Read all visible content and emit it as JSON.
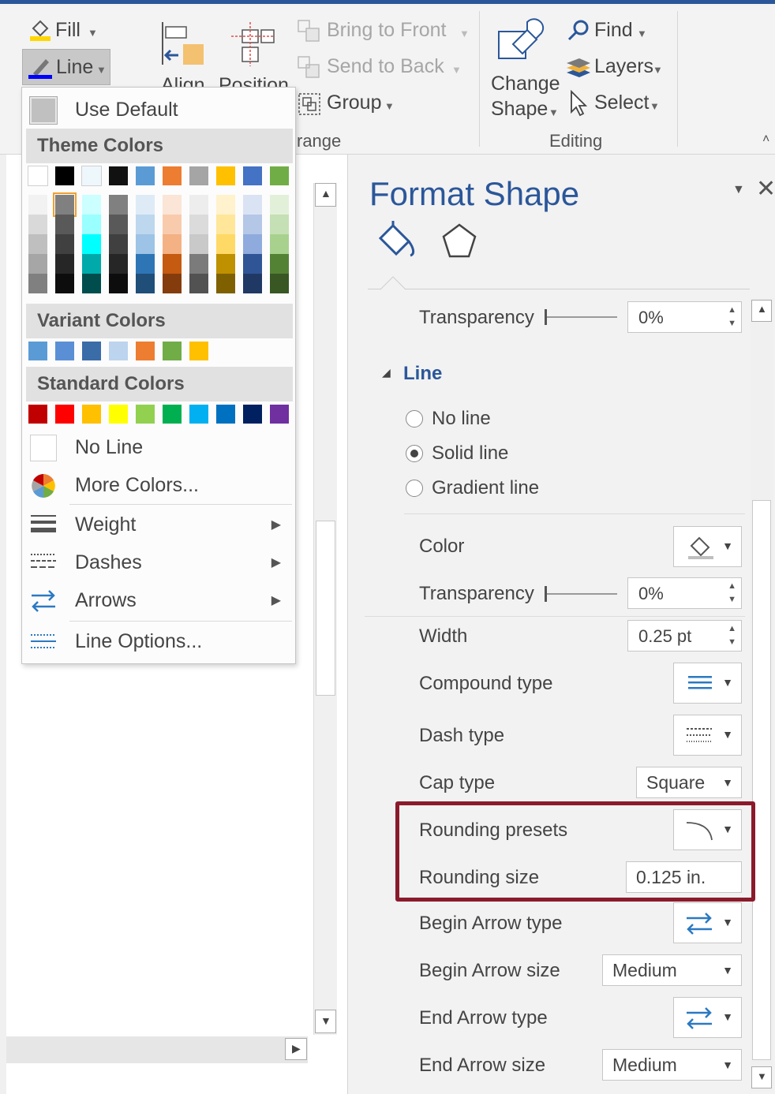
{
  "ribbon": {
    "fill_label": "Fill",
    "line_label": "Line",
    "align_label": "Align",
    "position_label": "Position",
    "bring_front": "Bring to Front",
    "send_back": "Send to Back",
    "group": "Group",
    "arrange_label": "range",
    "change_shape_1": "Change",
    "change_shape_2": "Shape",
    "find": "Find",
    "layers": "Layers",
    "select": "Select",
    "editing_label": "Editing"
  },
  "menu": {
    "use_default": "Use Default",
    "theme_colors": "Theme Colors",
    "variant_colors": "Variant Colors",
    "standard_colors": "Standard Colors",
    "no_line": "No Line",
    "more_colors": "More Colors...",
    "weight": "Weight",
    "dashes": "Dashes",
    "arrows": "Arrows",
    "line_options": "Line Options...",
    "theme_top": [
      "#ffffff",
      "#000000",
      "#eef7fb",
      "#111111",
      "#5b9bd5",
      "#ed7d31",
      "#a5a5a5",
      "#ffc000",
      "#4472c4",
      "#70ad47"
    ],
    "theme_shades": [
      [
        "#f2f2f2",
        "#d9d9d9",
        "#bfbfbf",
        "#a6a6a6",
        "#808080"
      ],
      [
        "#808080",
        "#595959",
        "#404040",
        "#262626",
        "#0d0d0d"
      ],
      [
        "#ccffff",
        "#99ffff",
        "#00ffff",
        "#00aaaa",
        "#004d4d"
      ],
      [
        "#808080",
        "#595959",
        "#404040",
        "#262626",
        "#0d0d0d"
      ],
      [
        "#deebf7",
        "#bdd7ee",
        "#9dc3e6",
        "#2e75b6",
        "#1f4e79"
      ],
      [
        "#fbe5d6",
        "#f8cbad",
        "#f4b183",
        "#c55a11",
        "#843c0c"
      ],
      [
        "#ededed",
        "#dbdbdb",
        "#c9c9c9",
        "#7b7b7b",
        "#525252"
      ],
      [
        "#fff2cc",
        "#ffe699",
        "#ffd966",
        "#bf9000",
        "#7f6000"
      ],
      [
        "#dae3f3",
        "#b4c7e7",
        "#8faadc",
        "#2f5597",
        "#203864"
      ],
      [
        "#e2f0d9",
        "#c5e0b4",
        "#a9d18e",
        "#548235",
        "#385723"
      ]
    ],
    "variant": [
      "#5b9bd5",
      "#5b8fd5",
      "#3a6ca8",
      "#bcd4ee",
      "#ed7d31",
      "#70ad47",
      "#ffc000"
    ],
    "standard": [
      "#c00000",
      "#ff0000",
      "#ffc000",
      "#ffff00",
      "#92d050",
      "#00b050",
      "#00b0f0",
      "#0070c0",
      "#002060",
      "#7030a0"
    ]
  },
  "pane": {
    "title": "Format Shape",
    "fill_transparency_label": "Transparency",
    "fill_transparency_value": "0%",
    "line_section": "Line",
    "no_line": "No line",
    "solid_line": "Solid line",
    "gradient_line": "Gradient line",
    "color": "Color",
    "transparency_label": "Transparency",
    "transparency_value": "0%",
    "width_label": "Width",
    "width_value": "0.25 pt",
    "compound_type": "Compound type",
    "dash_type": "Dash type",
    "cap_type": "Cap type",
    "cap_value": "Square",
    "rounding_presets": "Rounding presets",
    "rounding_size": "Rounding size",
    "rounding_size_value": "0.125 in.",
    "begin_arrow_type": "Begin Arrow type",
    "begin_arrow_size": "Begin Arrow size",
    "begin_arrow_size_value": "Medium",
    "end_arrow_type": "End Arrow type",
    "end_arrow_size": "End Arrow size",
    "end_arrow_size_value": "Medium"
  },
  "colors": {
    "accent": "#2b579a",
    "highlight_border": "#8b1a2b"
  }
}
